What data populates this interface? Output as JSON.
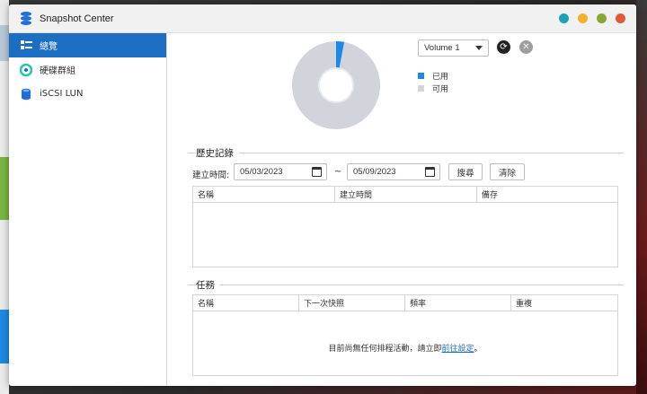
{
  "window": {
    "title": "Snapshot Center"
  },
  "colors": {
    "accent": "#1b6ec2",
    "used": "#1e88e5",
    "available": "#d1d5db",
    "ctrl_teal": "#1aa3b4",
    "ctrl_yellow": "#f4b22a",
    "ctrl_green": "#8aa631",
    "ctrl_red": "#e05a3a"
  },
  "sidebar": {
    "items": [
      {
        "label": "總覽",
        "icon": "grid-list-icon",
        "active": true
      },
      {
        "label": "硬碟群組",
        "icon": "disk-group-icon",
        "active": false
      },
      {
        "label": "iSCSI LUN",
        "icon": "database-icon",
        "active": false
      }
    ]
  },
  "overview": {
    "volume_select": "Volume 1",
    "legend": [
      {
        "label": "已用",
        "color": "#1e88e5"
      },
      {
        "label": "可用",
        "color": "#d1d5db"
      }
    ]
  },
  "chart_data": {
    "type": "pie",
    "categories": [
      "已用",
      "可用"
    ],
    "values": [
      3,
      97
    ]
  },
  "history": {
    "title": "歷史記錄",
    "filter_label": "建立時間:",
    "start_date": "05/03/2023",
    "separator": "~",
    "end_date": "05/09/2023",
    "search_label": "搜尋",
    "clear_label": "清除",
    "columns": [
      "名稱",
      "建立時間",
      "備存"
    ]
  },
  "tasks": {
    "title": "任務",
    "columns": [
      "名稱",
      "下一次快照",
      "頻率",
      "重複"
    ],
    "empty_text": "目前尚無任何排程活動，請立即",
    "empty_link": "前往設定",
    "empty_suffix": "。"
  }
}
